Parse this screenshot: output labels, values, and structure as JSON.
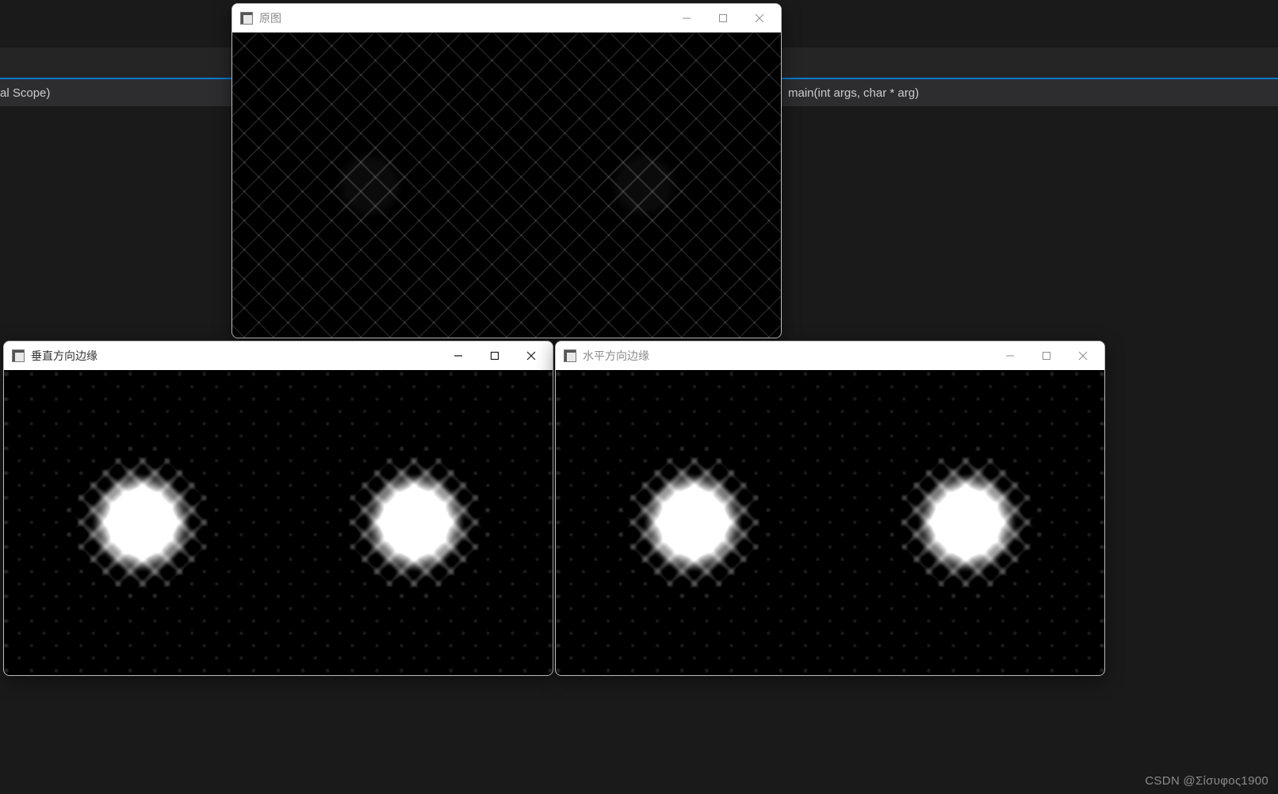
{
  "ide": {
    "left_crumb": "al Scope)",
    "right_crumb": "main(int args, char * arg)"
  },
  "windows": {
    "original": {
      "title": "原图",
      "active": false
    },
    "vertical": {
      "title": "垂直方向边缘",
      "active": true
    },
    "horizontal": {
      "title": "水平方向边缘",
      "active": false
    }
  },
  "watermark": "CSDN @Σίσυφος1900"
}
